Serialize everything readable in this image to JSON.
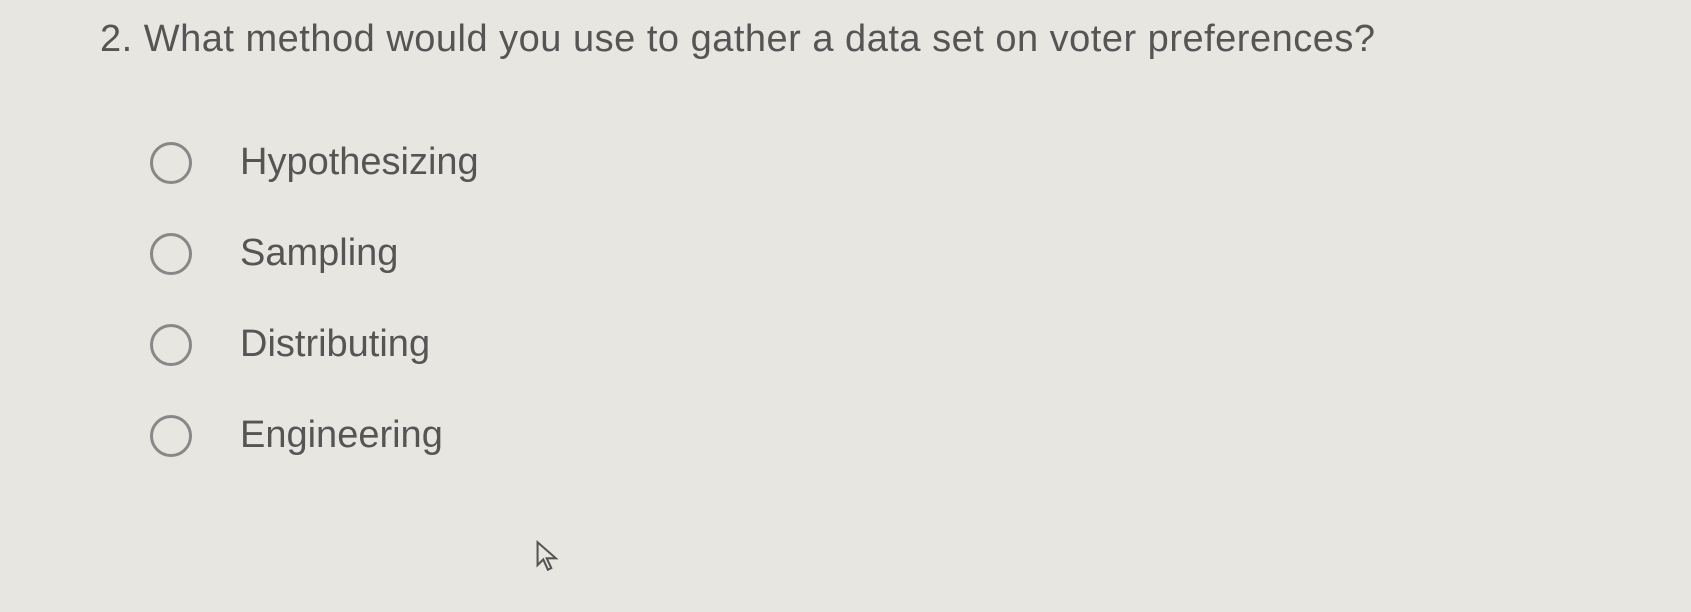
{
  "question": {
    "number": "2.",
    "text": "What method would you use to gather a data set on voter preferences?"
  },
  "options": [
    {
      "label": "Hypothesizing"
    },
    {
      "label": "Sampling"
    },
    {
      "label": "Distributing"
    },
    {
      "label": "Engineering"
    }
  ]
}
